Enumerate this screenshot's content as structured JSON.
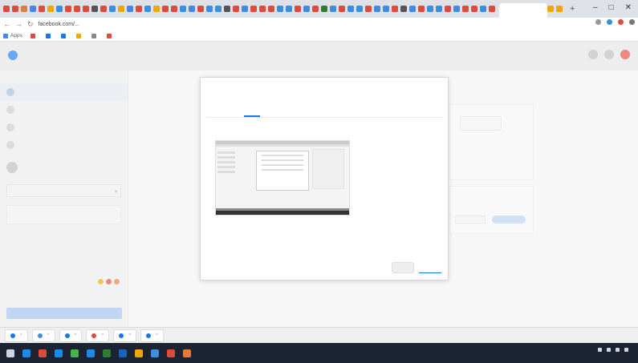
{
  "browser": {
    "tab_colors": [
      "#e0493b",
      "#e0493b",
      "#e07b3b",
      "#4a86e8",
      "#e0493b",
      "#f0a500",
      "#3b8ee0",
      "#e0493b",
      "#e0493b",
      "#e0493b",
      "#555555",
      "#e0493b",
      "#3b8ee0",
      "#f0a500",
      "#4a86e8",
      "#e0493b",
      "#3b8ee0",
      "#f0a500",
      "#e0493b",
      "#e0493b",
      "#3b8ee0",
      "#4a86e8",
      "#e0493b",
      "#3b8ee0",
      "#3b8ee0",
      "#555555",
      "#e0493b",
      "#3b8ee0",
      "#e0493b",
      "#e0493b",
      "#e0493b",
      "#3b8ee0",
      "#3b8ee0",
      "#e0493b",
      "#3b8ee0",
      "#e0493b",
      "#2e7d32",
      "#3b8ee0",
      "#e0493b",
      "#3b8ee0",
      "#3b8ee0",
      "#e0493b",
      "#3b8ee0",
      "#3b8ee0",
      "#e0493b",
      "#555555",
      "#3b8ee0",
      "#e0493b",
      "#3b8ee0",
      "#3b8ee0",
      "#e0493b",
      "#3b8ee0",
      "#e0493b",
      "#e0493b",
      "#3b8ee0",
      "#e0493b",
      "#f0a500",
      "#f0a500"
    ],
    "new_tab": "+",
    "window_controls": [
      "–",
      "□",
      "✕"
    ],
    "url": "facebook.com/...",
    "bookmarks": [
      {
        "label": "Apps",
        "color": "#4a86e8"
      },
      {
        "label": "",
        "color": "#e0493b"
      },
      {
        "label": "",
        "color": "#1877f2"
      },
      {
        "label": "",
        "color": "#1877f2"
      },
      {
        "label": "",
        "color": "#f0a500"
      },
      {
        "label": "",
        "color": "#888888"
      },
      {
        "label": "",
        "color": "#e0493b"
      }
    ]
  },
  "app": {
    "name": "",
    "sidebar_title": "",
    "sidebar_items": [
      {
        "icon": "home-icon",
        "label": "",
        "active": true
      },
      {
        "icon": "chat-icon",
        "label": "",
        "active": false
      },
      {
        "icon": "people-icon",
        "label": "",
        "active": false
      },
      {
        "icon": "list-icon",
        "label": "",
        "active": false
      }
    ],
    "account_label": "",
    "select_value": "",
    "select_caret": "▾",
    "primary_button": ""
  },
  "main": {
    "tabs": [
      "",
      ""
    ]
  },
  "modal": {
    "title": "",
    "subtitle": "",
    "tabs": [
      {
        "label": "",
        "active": true
      },
      {
        "label": "",
        "active": false
      },
      {
        "label": "",
        "active": false
      }
    ],
    "buttons": {
      "secondary": "",
      "primary": ""
    }
  },
  "bottom_tabs": [
    {
      "label": "",
      "color": "#1877f2"
    },
    {
      "label": "",
      "color": "#3b8ee0"
    },
    {
      "label": "",
      "color": "#1877f2"
    },
    {
      "label": "",
      "color": "#e0493b"
    },
    {
      "label": "",
      "color": "#1877f2"
    },
    {
      "label": "",
      "color": "#1877f2"
    }
  ],
  "taskbar": {
    "icons": [
      "#1e88e5",
      "#e0493b",
      "#1e88e5",
      "#4caf50",
      "#1e88e5",
      "#2e7d32",
      "#1565c0",
      "#f0a500",
      "#3b8ee0",
      "#e0493b",
      "#e07b3b"
    ],
    "time": ""
  }
}
